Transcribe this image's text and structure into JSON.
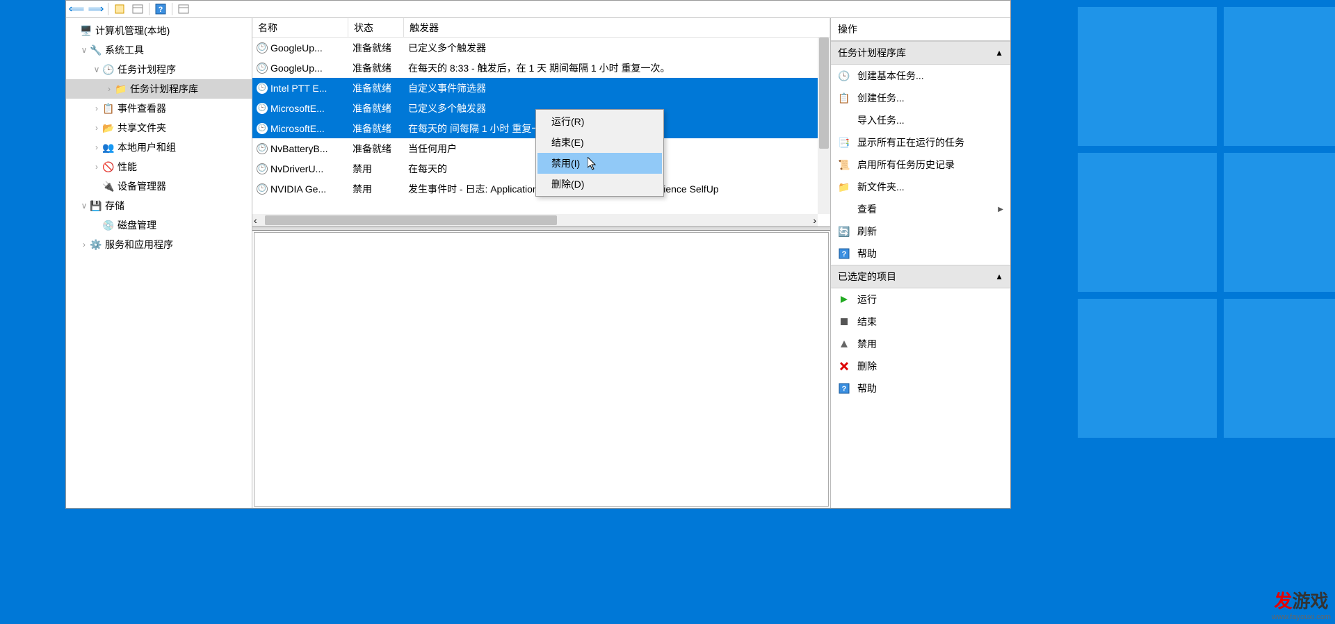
{
  "toolbar": {
    "nav_back": "⟸",
    "nav_fwd": "⟹"
  },
  "tree": {
    "root": "计算机管理(本地)",
    "system_tools": "系统工具",
    "task_scheduler": "任务计划程序",
    "task_lib": "任务计划程序库",
    "event_viewer": "事件查看器",
    "shared_folders": "共享文件夹",
    "local_users": "本地用户和组",
    "performance": "性能",
    "device_mgr": "设备管理器",
    "storage": "存储",
    "disk_mgmt": "磁盘管理",
    "services": "服务和应用程序"
  },
  "list": {
    "headers": {
      "name": "名称",
      "status": "状态",
      "trigger": "触发器"
    },
    "rows": [
      {
        "name": "GoogleUp...",
        "status": "准备就绪",
        "trigger": "已定义多个触发器",
        "selected": false
      },
      {
        "name": "GoogleUp...",
        "status": "准备就绪",
        "trigger": "在每天的 8:33 - 触发后，在 1 天 期间每隔 1 小时 重复一次。",
        "selected": false
      },
      {
        "name": "Intel PTT E...",
        "status": "准备就绪",
        "trigger": "自定义事件筛选器",
        "selected": true
      },
      {
        "name": "MicrosoftE...",
        "status": "准备就绪",
        "trigger": "已定义多个触发器",
        "selected": true
      },
      {
        "name": "MicrosoftE...",
        "status": "准备就绪",
        "trigger": "在每天的                                                 间每隔 1 小时 重复一次。",
        "selected": true
      },
      {
        "name": "NvBatteryB...",
        "status": "准备就绪",
        "trigger": "当任何用户",
        "selected": false
      },
      {
        "name": "NvDriverU...",
        "status": "禁用",
        "trigger": "在每天的",
        "selected": false
      },
      {
        "name": "NVIDIA Ge...",
        "status": "禁用",
        "trigger": "发生事件时 - 日志: Application，源: NVIDIA GeForce Experience SelfUp",
        "selected": false
      }
    ]
  },
  "context": {
    "run": "运行(R)",
    "end": "结束(E)",
    "disable": "禁用(I)",
    "delete": "删除(D)"
  },
  "actions": {
    "header": "操作",
    "section1": "任务计划程序库",
    "create_basic": "创建基本任务...",
    "create_task": "创建任务...",
    "import": "导入任务...",
    "show_running": "显示所有正在运行的任务",
    "enable_history": "启用所有任务历史记录",
    "new_folder": "新文件夹...",
    "view": "查看",
    "refresh": "刷新",
    "help": "帮助",
    "section2": "已选定的项目",
    "run": "运行",
    "end": "结束",
    "disable": "禁用",
    "delete": "删除",
    "help2": "帮助"
  },
  "watermark": {
    "brand1": "发",
    "brand2": "游戏",
    "url": "www.fayouxi.com"
  }
}
